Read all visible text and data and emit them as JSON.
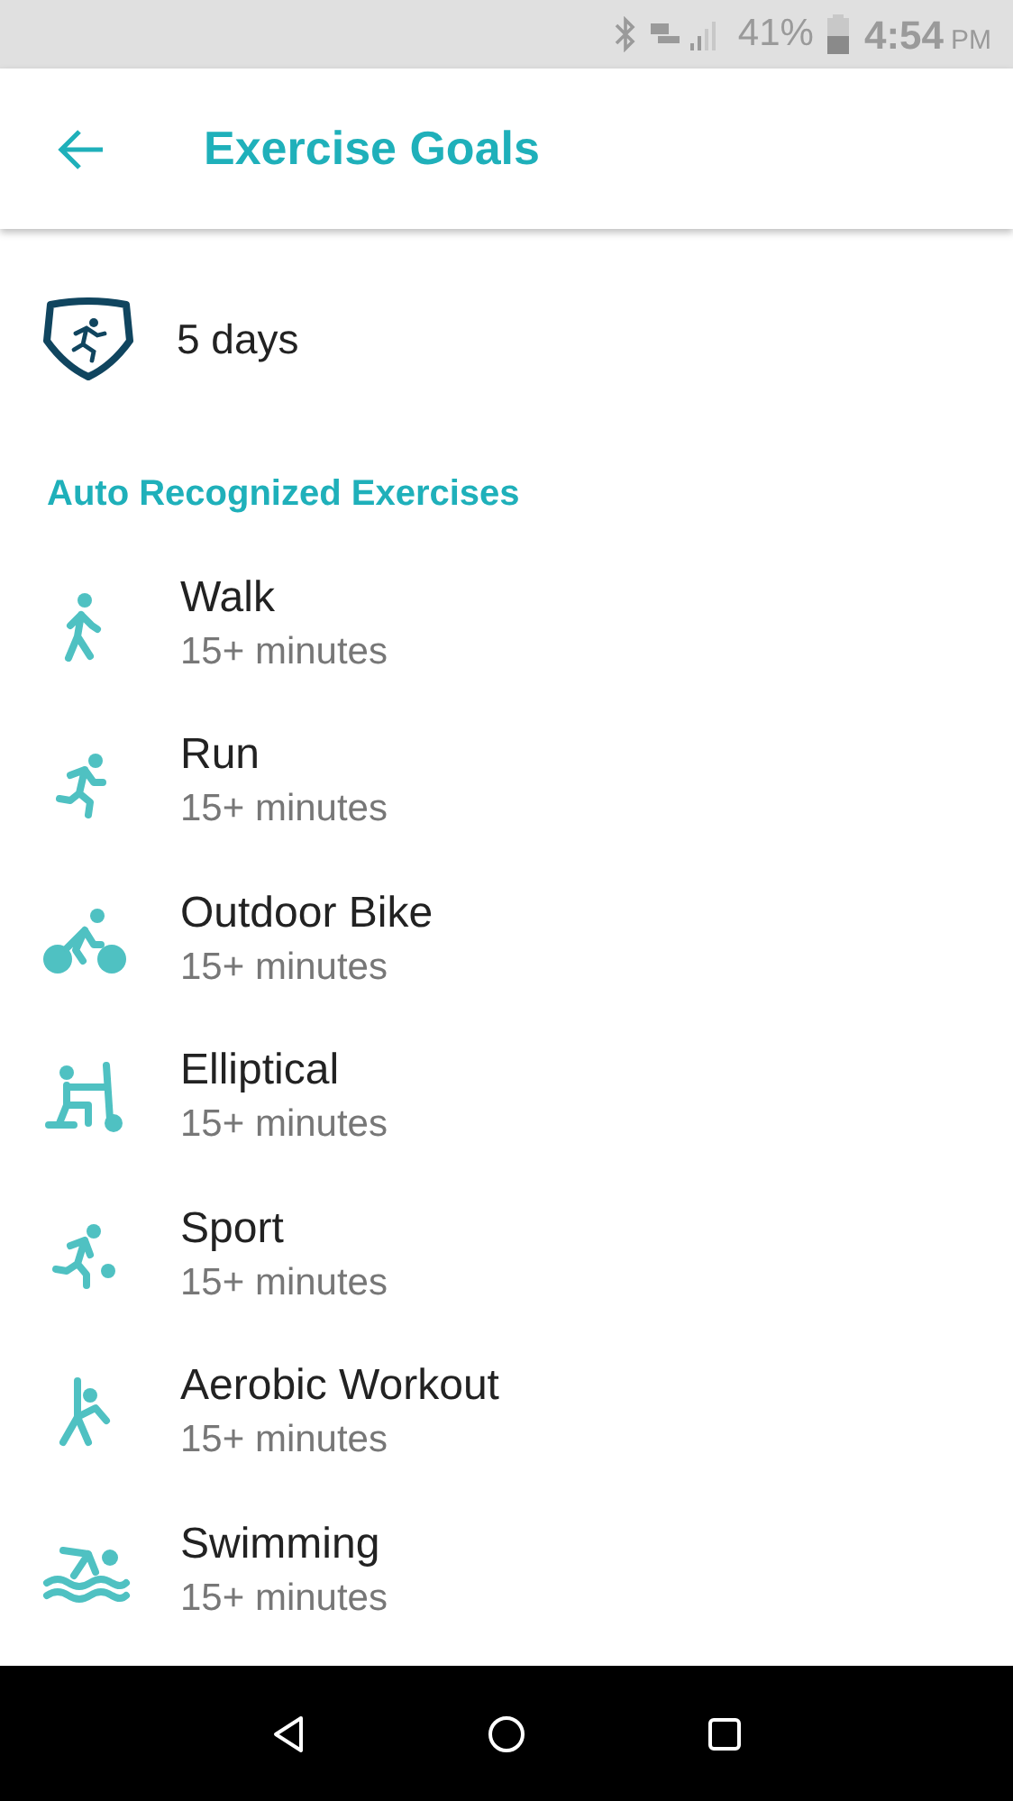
{
  "status_bar": {
    "battery": "41%",
    "time": "4:54",
    "ampm": "PM"
  },
  "header": {
    "title": "Exercise Goals"
  },
  "goal": {
    "value": "5 days"
  },
  "section": {
    "title": "Auto Recognized Exercises"
  },
  "exercises": [
    {
      "kind": "walk",
      "name": "Walk",
      "duration": "15+ minutes"
    },
    {
      "kind": "run",
      "name": "Run",
      "duration": "15+ minutes"
    },
    {
      "kind": "bike",
      "name": "Outdoor Bike",
      "duration": "15+ minutes"
    },
    {
      "kind": "elliptical",
      "name": "Elliptical",
      "duration": "15+ minutes"
    },
    {
      "kind": "sport",
      "name": "Sport",
      "duration": "15+ minutes"
    },
    {
      "kind": "aerobic",
      "name": "Aerobic Workout",
      "duration": "15+ minutes"
    },
    {
      "kind": "swim",
      "name": "Swimming",
      "duration": "15+ minutes"
    }
  ]
}
